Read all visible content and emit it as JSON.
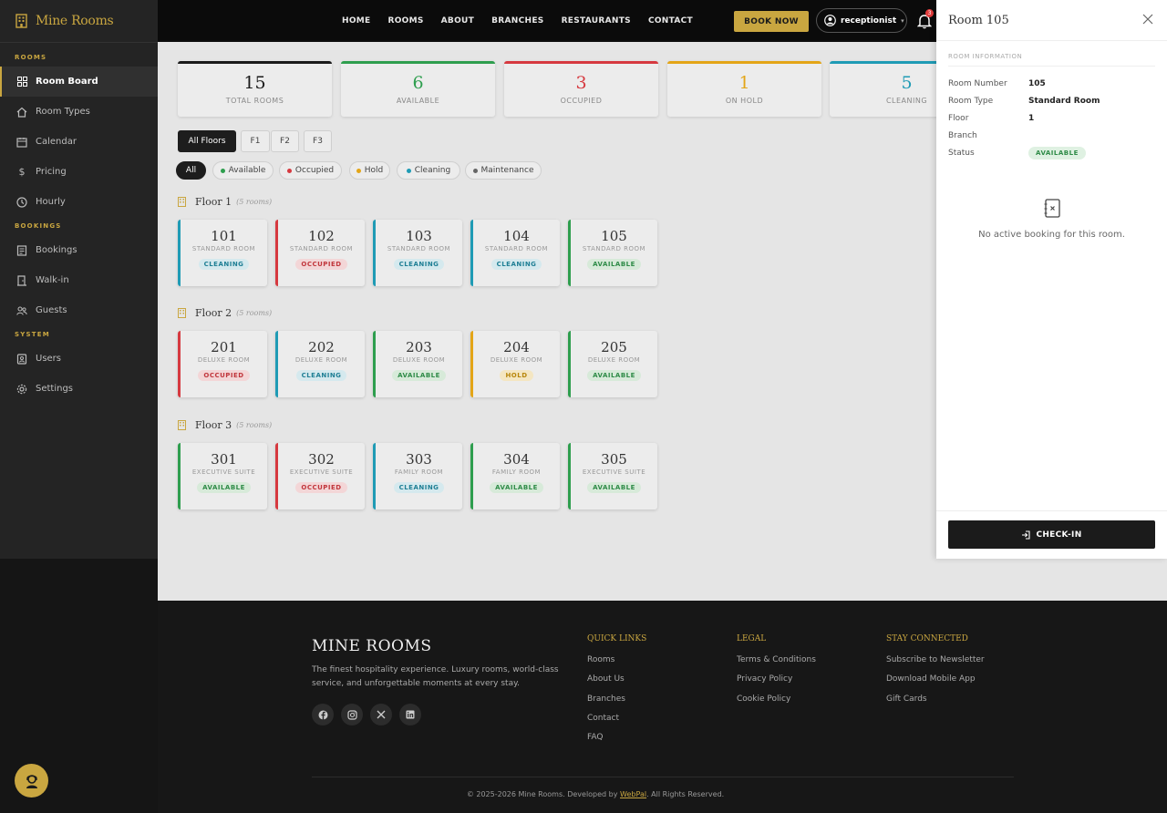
{
  "brand": {
    "name": "Mine Rooms"
  },
  "sidebar": {
    "sections": [
      {
        "title": "ROOMS",
        "items": [
          {
            "label": "Room Board",
            "icon": "grid-icon",
            "active": true
          },
          {
            "label": "Room Types",
            "icon": "home-icon"
          },
          {
            "label": "Calendar",
            "icon": "calendar-icon"
          },
          {
            "label": "Pricing",
            "icon": "dollar-icon"
          },
          {
            "label": "Hourly",
            "icon": "clock-icon"
          }
        ]
      },
      {
        "title": "BOOKINGS",
        "items": [
          {
            "label": "Bookings",
            "icon": "list-icon"
          },
          {
            "label": "Walk-in",
            "icon": "door-icon"
          },
          {
            "label": "Guests",
            "icon": "users-icon"
          }
        ]
      },
      {
        "title": "SYSTEM",
        "items": [
          {
            "label": "Users",
            "icon": "user-card-icon"
          },
          {
            "label": "Settings",
            "icon": "gear-icon"
          }
        ]
      }
    ]
  },
  "topnav": {
    "links": [
      "HOME",
      "ROOMS",
      "ABOUT",
      "BRANCHES",
      "RESTAURANTS",
      "CONTACT"
    ],
    "book_now": "BOOK NOW",
    "user": "receptionist",
    "notifications": "3"
  },
  "stats": [
    {
      "num": "15",
      "label": "TOTAL ROOMS",
      "color": "#1a1a1a"
    },
    {
      "num": "6",
      "label": "AVAILABLE",
      "color": "#2e9e4e"
    },
    {
      "num": "3",
      "label": "OCCUPIED",
      "color": "#d6393f"
    },
    {
      "num": "1",
      "label": "ON HOLD",
      "color": "#e3a517"
    },
    {
      "num": "5",
      "label": "CLEANING",
      "color": "#1f9bb5"
    }
  ],
  "floor_tabs": [
    "All Floors",
    "F1",
    "F2",
    "F3"
  ],
  "status_filters": [
    {
      "label": "All"
    },
    {
      "label": "Available",
      "color": "#2e9e4e"
    },
    {
      "label": "Occupied",
      "color": "#d6393f"
    },
    {
      "label": "Hold",
      "color": "#e3a517"
    },
    {
      "label": "Cleaning",
      "color": "#1f9bb5"
    },
    {
      "label": "Maintenance",
      "color": "#666666"
    }
  ],
  "floors": [
    {
      "title": "Floor 1",
      "count": "(5 rooms)",
      "rooms": [
        {
          "number": "101",
          "type": "STANDARD ROOM",
          "status": "CLEANING"
        },
        {
          "number": "102",
          "type": "STANDARD ROOM",
          "status": "OCCUPIED"
        },
        {
          "number": "103",
          "type": "STANDARD ROOM",
          "status": "CLEANING"
        },
        {
          "number": "104",
          "type": "STANDARD ROOM",
          "status": "CLEANING"
        },
        {
          "number": "105",
          "type": "STANDARD ROOM",
          "status": "AVAILABLE"
        }
      ]
    },
    {
      "title": "Floor 2",
      "count": "(5 rooms)",
      "rooms": [
        {
          "number": "201",
          "type": "DELUXE ROOM",
          "status": "OCCUPIED"
        },
        {
          "number": "202",
          "type": "DELUXE ROOM",
          "status": "CLEANING"
        },
        {
          "number": "203",
          "type": "DELUXE ROOM",
          "status": "AVAILABLE"
        },
        {
          "number": "204",
          "type": "DELUXE ROOM",
          "status": "HOLD"
        },
        {
          "number": "205",
          "type": "DELUXE ROOM",
          "status": "AVAILABLE"
        }
      ]
    },
    {
      "title": "Floor 3",
      "count": "(5 rooms)",
      "rooms": [
        {
          "number": "301",
          "type": "EXECUTIVE SUITE",
          "status": "AVAILABLE"
        },
        {
          "number": "302",
          "type": "EXECUTIVE SUITE",
          "status": "OCCUPIED"
        },
        {
          "number": "303",
          "type": "FAMILY ROOM",
          "status": "CLEANING"
        },
        {
          "number": "304",
          "type": "FAMILY ROOM",
          "status": "AVAILABLE"
        },
        {
          "number": "305",
          "type": "EXECUTIVE SUITE",
          "status": "AVAILABLE"
        }
      ]
    }
  ],
  "status_colors": {
    "CLEANING": {
      "border": "#1f9bb5",
      "bg": "#d5e9ee",
      "fg": "#1f7f95"
    },
    "OCCUPIED": {
      "border": "#d6393f",
      "bg": "#f3d6d7",
      "fg": "#c1363c"
    },
    "AVAILABLE": {
      "border": "#2e9e4e",
      "bg": "#d7ead9",
      "fg": "#2e8b47"
    },
    "HOLD": {
      "border": "#e3a517",
      "bg": "#f4e6c2",
      "fg": "#b8860b"
    }
  },
  "panel": {
    "title": "Room 105",
    "section": "ROOM INFORMATION",
    "fields": [
      {
        "key": "Room Number",
        "value": "105"
      },
      {
        "key": "Room Type",
        "value": "Standard Room"
      },
      {
        "key": "Floor",
        "value": "1"
      },
      {
        "key": "Branch",
        "value": ""
      },
      {
        "key": "Status",
        "value": "AVAILABLE"
      }
    ],
    "no_booking": "No active booking for this room.",
    "checkin": "CHECK-IN"
  },
  "footer": {
    "brand": "MINE ROOMS",
    "desc": "The finest hospitality experience. Luxury rooms, world-class service, and unforgettable moments at every stay.",
    "social": [
      "facebook-icon",
      "instagram-icon",
      "x-icon",
      "linkedin-icon"
    ],
    "columns": [
      {
        "title": "QUICK LINKS",
        "links": [
          "Rooms",
          "About Us",
          "Branches",
          "Contact",
          "FAQ"
        ]
      },
      {
        "title": "LEGAL",
        "links": [
          "Terms & Conditions",
          "Privacy Policy",
          "Cookie Policy"
        ]
      },
      {
        "title": "STAY CONNECTED",
        "links": [
          "Subscribe to Newsletter",
          "Download Mobile App",
          "Gift Cards"
        ]
      }
    ],
    "copy_pre": "© 2025-2026 Mine Rooms. Developed by ",
    "copy_dev": "WebPal",
    "copy_post": ". All Rights Reserved."
  }
}
